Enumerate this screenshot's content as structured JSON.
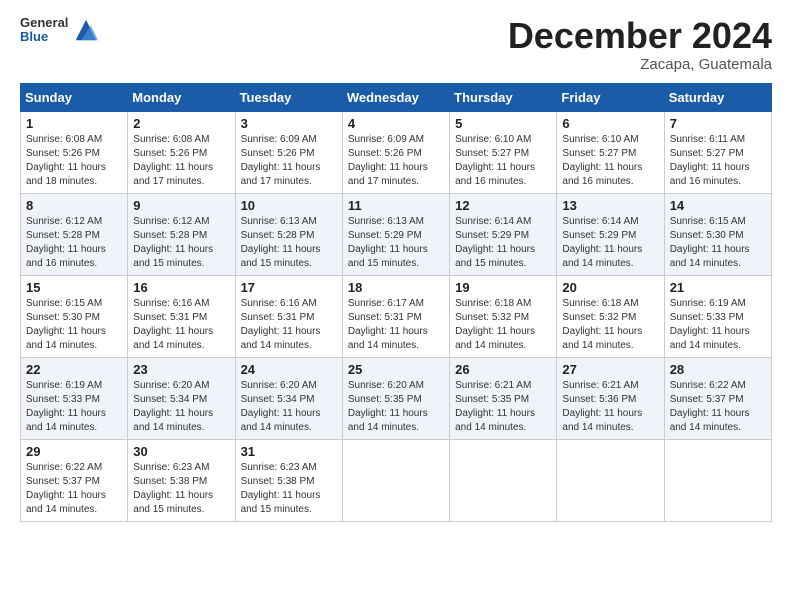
{
  "header": {
    "logo_general": "General",
    "logo_blue": "Blue",
    "month_title": "December 2024",
    "location": "Zacapa, Guatemala"
  },
  "weekdays": [
    "Sunday",
    "Monday",
    "Tuesday",
    "Wednesday",
    "Thursday",
    "Friday",
    "Saturday"
  ],
  "weeks": [
    [
      {
        "day": "1",
        "sunrise": "6:08 AM",
        "sunset": "5:26 PM",
        "daylight": "11 hours and 18 minutes."
      },
      {
        "day": "2",
        "sunrise": "6:08 AM",
        "sunset": "5:26 PM",
        "daylight": "11 hours and 17 minutes."
      },
      {
        "day": "3",
        "sunrise": "6:09 AM",
        "sunset": "5:26 PM",
        "daylight": "11 hours and 17 minutes."
      },
      {
        "day": "4",
        "sunrise": "6:09 AM",
        "sunset": "5:26 PM",
        "daylight": "11 hours and 17 minutes."
      },
      {
        "day": "5",
        "sunrise": "6:10 AM",
        "sunset": "5:27 PM",
        "daylight": "11 hours and 16 minutes."
      },
      {
        "day": "6",
        "sunrise": "6:10 AM",
        "sunset": "5:27 PM",
        "daylight": "11 hours and 16 minutes."
      },
      {
        "day": "7",
        "sunrise": "6:11 AM",
        "sunset": "5:27 PM",
        "daylight": "11 hours and 16 minutes."
      }
    ],
    [
      {
        "day": "8",
        "sunrise": "6:12 AM",
        "sunset": "5:28 PM",
        "daylight": "11 hours and 16 minutes."
      },
      {
        "day": "9",
        "sunrise": "6:12 AM",
        "sunset": "5:28 PM",
        "daylight": "11 hours and 15 minutes."
      },
      {
        "day": "10",
        "sunrise": "6:13 AM",
        "sunset": "5:28 PM",
        "daylight": "11 hours and 15 minutes."
      },
      {
        "day": "11",
        "sunrise": "6:13 AM",
        "sunset": "5:29 PM",
        "daylight": "11 hours and 15 minutes."
      },
      {
        "day": "12",
        "sunrise": "6:14 AM",
        "sunset": "5:29 PM",
        "daylight": "11 hours and 15 minutes."
      },
      {
        "day": "13",
        "sunrise": "6:14 AM",
        "sunset": "5:29 PM",
        "daylight": "11 hours and 14 minutes."
      },
      {
        "day": "14",
        "sunrise": "6:15 AM",
        "sunset": "5:30 PM",
        "daylight": "11 hours and 14 minutes."
      }
    ],
    [
      {
        "day": "15",
        "sunrise": "6:15 AM",
        "sunset": "5:30 PM",
        "daylight": "11 hours and 14 minutes."
      },
      {
        "day": "16",
        "sunrise": "6:16 AM",
        "sunset": "5:31 PM",
        "daylight": "11 hours and 14 minutes."
      },
      {
        "day": "17",
        "sunrise": "6:16 AM",
        "sunset": "5:31 PM",
        "daylight": "11 hours and 14 minutes."
      },
      {
        "day": "18",
        "sunrise": "6:17 AM",
        "sunset": "5:31 PM",
        "daylight": "11 hours and 14 minutes."
      },
      {
        "day": "19",
        "sunrise": "6:18 AM",
        "sunset": "5:32 PM",
        "daylight": "11 hours and 14 minutes."
      },
      {
        "day": "20",
        "sunrise": "6:18 AM",
        "sunset": "5:32 PM",
        "daylight": "11 hours and 14 minutes."
      },
      {
        "day": "21",
        "sunrise": "6:19 AM",
        "sunset": "5:33 PM",
        "daylight": "11 hours and 14 minutes."
      }
    ],
    [
      {
        "day": "22",
        "sunrise": "6:19 AM",
        "sunset": "5:33 PM",
        "daylight": "11 hours and 14 minutes."
      },
      {
        "day": "23",
        "sunrise": "6:20 AM",
        "sunset": "5:34 PM",
        "daylight": "11 hours and 14 minutes."
      },
      {
        "day": "24",
        "sunrise": "6:20 AM",
        "sunset": "5:34 PM",
        "daylight": "11 hours and 14 minutes."
      },
      {
        "day": "25",
        "sunrise": "6:20 AM",
        "sunset": "5:35 PM",
        "daylight": "11 hours and 14 minutes."
      },
      {
        "day": "26",
        "sunrise": "6:21 AM",
        "sunset": "5:35 PM",
        "daylight": "11 hours and 14 minutes."
      },
      {
        "day": "27",
        "sunrise": "6:21 AM",
        "sunset": "5:36 PM",
        "daylight": "11 hours and 14 minutes."
      },
      {
        "day": "28",
        "sunrise": "6:22 AM",
        "sunset": "5:37 PM",
        "daylight": "11 hours and 14 minutes."
      }
    ],
    [
      {
        "day": "29",
        "sunrise": "6:22 AM",
        "sunset": "5:37 PM",
        "daylight": "11 hours and 14 minutes."
      },
      {
        "day": "30",
        "sunrise": "6:23 AM",
        "sunset": "5:38 PM",
        "daylight": "11 hours and 15 minutes."
      },
      {
        "day": "31",
        "sunrise": "6:23 AM",
        "sunset": "5:38 PM",
        "daylight": "11 hours and 15 minutes."
      },
      null,
      null,
      null,
      null
    ]
  ]
}
